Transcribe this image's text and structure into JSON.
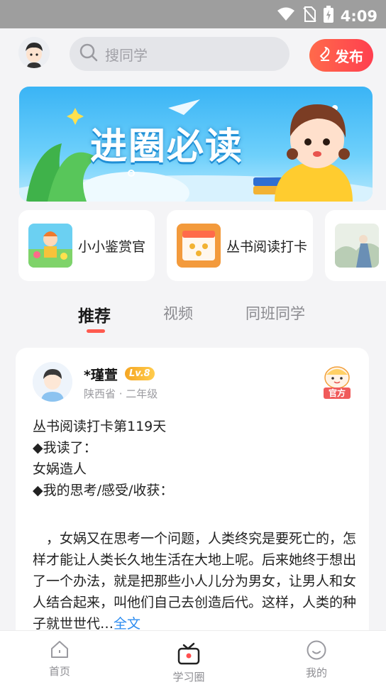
{
  "status_bar": {
    "time": "4:09"
  },
  "header": {
    "search_placeholder": "搜同学",
    "publish_label": "发布"
  },
  "banner": {
    "title": "进圈必读"
  },
  "feature_cards": [
    {
      "label": "小小鉴赏官"
    },
    {
      "label": "丛书阅读打卡"
    },
    {
      "label": ""
    }
  ],
  "tabs": [
    {
      "label": "推荐",
      "active": true
    },
    {
      "label": "视频",
      "active": false
    },
    {
      "label": "同班同学",
      "active": false
    }
  ],
  "post": {
    "author": "*瑾萱",
    "level": "Lv.8",
    "meta": "陕西省 · 二年级",
    "official_badge": "官方",
    "lines": [
      "丛书阅读打卡第119天",
      "◆我读了：",
      "女娲造人",
      "◆我的思考/感受/收获：",
      "",
      "　，女娲又在思考一个问题，人类终究是要死亡的，怎样才能让人类长久地生活在大地上呢。后来她终于想出了一个办法，就是把那些小人儿分为男女，让男人和女人结合起来，叫他们自己去创造后代。这样，人类的种子就世世代…"
    ],
    "full_text_link": "全文"
  },
  "bottom_nav": [
    {
      "label": "首页",
      "icon": "home-icon"
    },
    {
      "label": "学习圈",
      "icon": "study-circle-icon",
      "active": true
    },
    {
      "label": "我的",
      "icon": "profile-icon"
    }
  ],
  "colors": {
    "accent": "#ff4f4f",
    "link": "#2c8cf0",
    "level_badge": "#f5a623"
  }
}
